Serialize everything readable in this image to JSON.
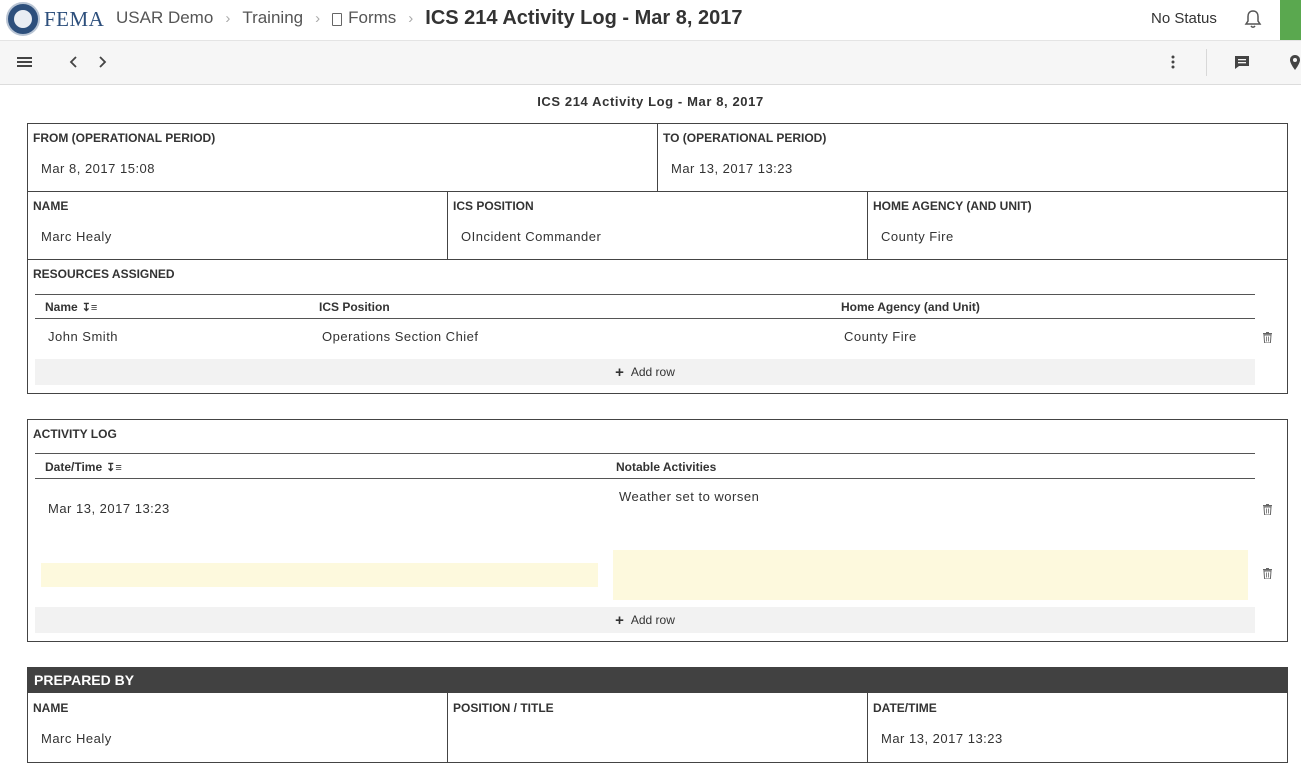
{
  "header": {
    "logo_text": "FEMA",
    "breadcrumbs": [
      "USAR Demo",
      "Training",
      "Forms"
    ],
    "title": "ICS 214 Activity Log - Mar 8, 2017",
    "status": "No Status"
  },
  "toolbar": {
    "icons": [
      "menu-icon",
      "chevron-left-icon",
      "chevron-right-icon",
      "more-vert-icon",
      "comment-icon",
      "location-pin-icon"
    ]
  },
  "form": {
    "title": "ICS 214 Activity Log - Mar 8, 2017",
    "period": {
      "from_label": "FROM (OPERATIONAL PERIOD)",
      "from_value": "Mar 8, 2017 15:08",
      "to_label": "TO (OPERATIONAL PERIOD)",
      "to_value": "Mar 13, 2017 13:23"
    },
    "person": {
      "name_label": "NAME",
      "name_value": "Marc Healy",
      "position_label": "ICS POSITION",
      "position_value": "OIncident Commander",
      "agency_label": "HOME AGENCY (AND UNIT)",
      "agency_value": "County Fire"
    },
    "resources": {
      "label": "RESOURCES ASSIGNED",
      "columns": [
        "Name",
        "ICS Position",
        "Home Agency (and Unit)"
      ],
      "rows": [
        [
          "John Smith",
          "Operations Section Chief",
          "County Fire"
        ]
      ],
      "add_row": "Add row"
    },
    "activity": {
      "label": "ACTIVITY LOG",
      "columns": [
        "Date/Time",
        "Notable Activities"
      ],
      "rows": [
        [
          "Mar 13, 2017 13:23",
          "Weather set to worsen"
        ],
        [
          "",
          ""
        ]
      ],
      "add_row": "Add row"
    },
    "prepared": {
      "label": "PREPARED BY",
      "name_label": "NAME",
      "name_value": "Marc Healy",
      "position_label": "POSITION / TITLE",
      "position_value": "",
      "datetime_label": "DATE/TIME",
      "datetime_value": "Mar 13, 2017 13:23"
    }
  },
  "colors": {
    "brand_blue": "#2d4f7c",
    "status_green": "#5aa84f",
    "section_dark": "#414141",
    "empty_field": "#fdf9dd"
  }
}
